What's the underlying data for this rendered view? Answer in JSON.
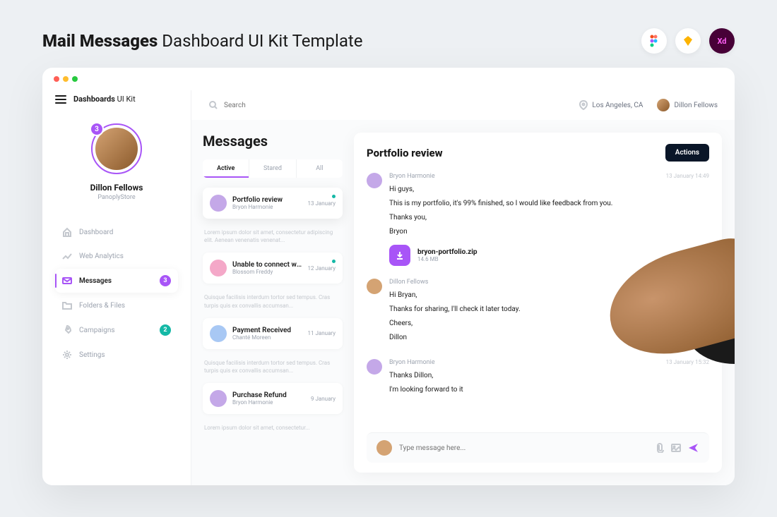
{
  "page": {
    "title_bold": "Mail Messages",
    "title_light": " Dashboard UI Kit Template"
  },
  "brand": {
    "bold": "Dashboards",
    "light": " UI Kit"
  },
  "profile": {
    "name": "Dillon Fellows",
    "subtitle": "PanoplyStore",
    "badge": "3"
  },
  "nav": [
    {
      "label": "Dashboard",
      "icon": "home"
    },
    {
      "label": "Web Analytics",
      "icon": "chart"
    },
    {
      "label": "Messages",
      "icon": "mail",
      "badge": "3",
      "badgeColor": "purple",
      "active": true
    },
    {
      "label": "Folders & Files",
      "icon": "folder"
    },
    {
      "label": "Campaigns",
      "icon": "rocket",
      "badge": "2",
      "badgeColor": "teal"
    },
    {
      "label": "Settings",
      "icon": "gear"
    }
  ],
  "search": {
    "placeholder": "Search"
  },
  "location": {
    "text": "Los Angeles, CA"
  },
  "topUser": {
    "name": "Dillon Fellows"
  },
  "messages": {
    "heading": "Messages",
    "tabs": [
      "Active",
      "Stared",
      "All"
    ],
    "items": [
      {
        "title": "Portfolio review",
        "sender": "Bryon Harmonie",
        "date": "13 January",
        "unread": true,
        "preview": "Lorem ipsum dolor sit amet, consectetur adipiscing elit. Aenean venenatis venenat...",
        "avatarColor": "#c4a8e8"
      },
      {
        "title": "Unable to connect with...",
        "sender": "Blossom Freddy",
        "date": "12 January",
        "unread": true,
        "preview": "Quisque facilisis interdum tortor sed tempus. Cras turpis quis ex convallis accumsan...",
        "avatarColor": "#f4a8c8"
      },
      {
        "title": "Payment Received",
        "sender": "Chanté Moreen",
        "date": "11 January",
        "preview": "Quisque facilisis interdum tortor sed tempus. Cras turpis quis ex convallis accumsan...",
        "avatarColor": "#a8c8f4"
      },
      {
        "title": "Purchase Refund",
        "sender": "Bryon Harmonie",
        "date": "9 January",
        "preview": "Lorem ipsum dolor sit amet, consectetur...",
        "avatarColor": "#c4a8e8"
      }
    ]
  },
  "thread": {
    "title": "Portfolio review",
    "actionsLabel": "Actions",
    "replies": [
      {
        "author": "Bryon Harmonie",
        "time": "13 January 14:49",
        "avatarColor": "#c4a8e8",
        "lines": [
          "Hi guys,",
          "This is my portfolio, it's 99% finished, so I would like feedback from you.",
          "Thanks you,",
          "Bryon"
        ],
        "attachment": {
          "name": "bryon-portfolio.zip",
          "size": "14.6 MB"
        }
      },
      {
        "author": "Dillon Fellows",
        "time": "",
        "avatarColor": "#d4a373",
        "lines": [
          "Hi Bryan,",
          "Thanks for sharing, I'll check it later today.",
          "Cheers,",
          "Dillon"
        ]
      },
      {
        "author": "Bryon Harmonie",
        "time": "13 January 15:32",
        "avatarColor": "#c4a8e8",
        "lines": [
          "Thanks Dillon,",
          "I'm looking forward to it"
        ]
      }
    ],
    "composerPlaceholder": "Type message here..."
  }
}
